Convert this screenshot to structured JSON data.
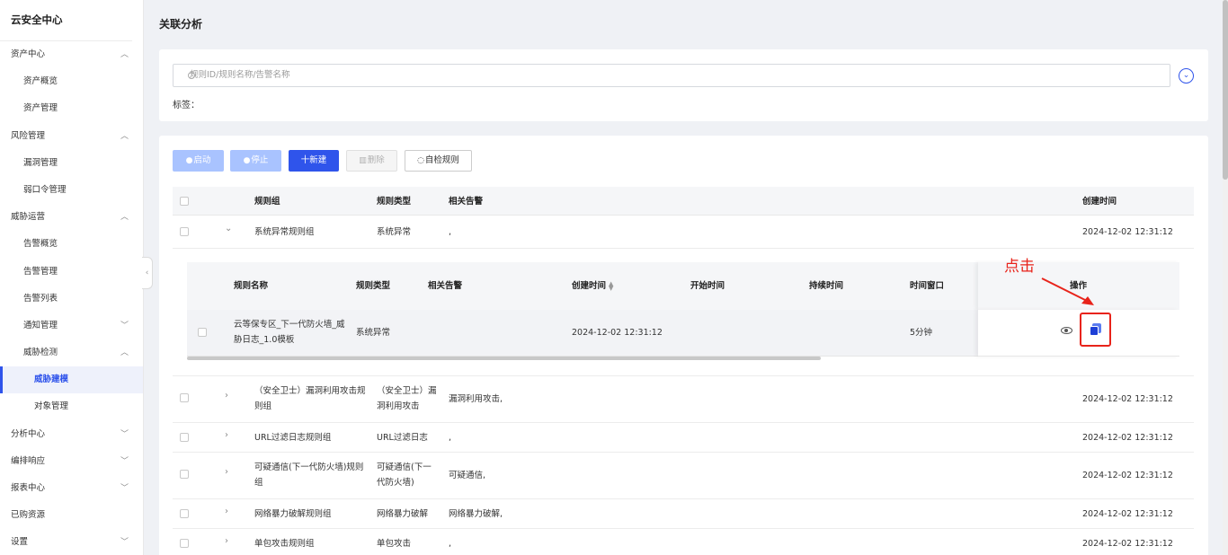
{
  "sidebar": {
    "title": "云安全中心",
    "items": [
      {
        "label": "资产中心",
        "level": "group",
        "caret": "up"
      },
      {
        "label": "资产概览",
        "level": "child"
      },
      {
        "label": "资产管理",
        "level": "child"
      },
      {
        "label": "风险管理",
        "level": "group",
        "caret": "up"
      },
      {
        "label": "漏洞管理",
        "level": "child"
      },
      {
        "label": "弱口令管理",
        "level": "child"
      },
      {
        "label": "威胁运营",
        "level": "group",
        "caret": "up"
      },
      {
        "label": "告警概览",
        "level": "child"
      },
      {
        "label": "告警管理",
        "level": "child"
      },
      {
        "label": "告警列表",
        "level": "child"
      },
      {
        "label": "通知管理",
        "level": "child",
        "caret": "down"
      },
      {
        "label": "威胁检测",
        "level": "child",
        "caret": "up"
      },
      {
        "label": "威胁建模",
        "level": "grandchild",
        "active": true
      },
      {
        "label": "对象管理",
        "level": "grandchild"
      },
      {
        "label": "分析中心",
        "level": "group",
        "caret": "down"
      },
      {
        "label": "编排响应",
        "level": "group",
        "caret": "down"
      },
      {
        "label": "报表中心",
        "level": "group",
        "caret": "down"
      },
      {
        "label": "已购资源",
        "level": "group"
      },
      {
        "label": "设置",
        "level": "group",
        "caret": "down"
      }
    ],
    "collapse_glyph": "‹"
  },
  "page_title": "关联分析",
  "filter": {
    "search_placeholder": "规则ID/规则名称/告警名称",
    "tag_label": "标签：",
    "expand_glyph": "⌄"
  },
  "toolbar": {
    "start_label": "启动",
    "stop_label": "停止",
    "new_label": "十新建",
    "delete_label": "删除",
    "selfcheck_label": "自检规则"
  },
  "table": {
    "headers": {
      "group": "规则组",
      "type": "规则类型",
      "alerts": "相关告警",
      "created": "创建时间"
    },
    "rows": [
      {
        "group": "系统异常规则组",
        "type": "系统异常",
        "alerts": ",",
        "created": "2024-12-02 12:31:12",
        "expanded": true
      },
      {
        "group": "（安全卫士）漏洞利用攻击规则组",
        "type": "（安全卫士）漏洞利用攻击",
        "alerts": "漏洞利用攻击,",
        "created": "2024-12-02 12:31:12"
      },
      {
        "group": "URL过滤日志规则组",
        "type": "URL过滤日志",
        "alerts": ",",
        "created": "2024-12-02 12:31:12"
      },
      {
        "group": "可疑通信(下一代防火墙)规则组",
        "type": "可疑通信(下一代防火墙)",
        "alerts": "可疑通信,",
        "created": "2024-12-02 12:31:12"
      },
      {
        "group": "网络暴力破解规则组",
        "type": "网络暴力破解",
        "alerts": "网络暴力破解,",
        "created": "2024-12-02 12:31:12"
      },
      {
        "group": "单包攻击规则组",
        "type": "单包攻击",
        "alerts": ",",
        "created": "2024-12-02 12:31:12"
      }
    ]
  },
  "subtable": {
    "headers": {
      "name": "规则名称",
      "type": "规则类型",
      "alerts": "相关告警",
      "created": "创建时间",
      "start": "开始时间",
      "duration": "持续时间",
      "window": "时间窗口",
      "ops": "操作"
    },
    "row": {
      "name": "云等保专区_下一代防火墙_威胁日志_1.0模板",
      "type": "系统异常",
      "alerts": "",
      "created": "2024-12-02 12:31:12",
      "start": "",
      "duration": "",
      "window": "5分钟"
    }
  },
  "annotation": {
    "text": "点击",
    "color": "#e8231a"
  },
  "colors": {
    "primary": "#2f54eb",
    "disabled_primary": "#a9c3ff",
    "annotation_red": "#e8231a"
  }
}
